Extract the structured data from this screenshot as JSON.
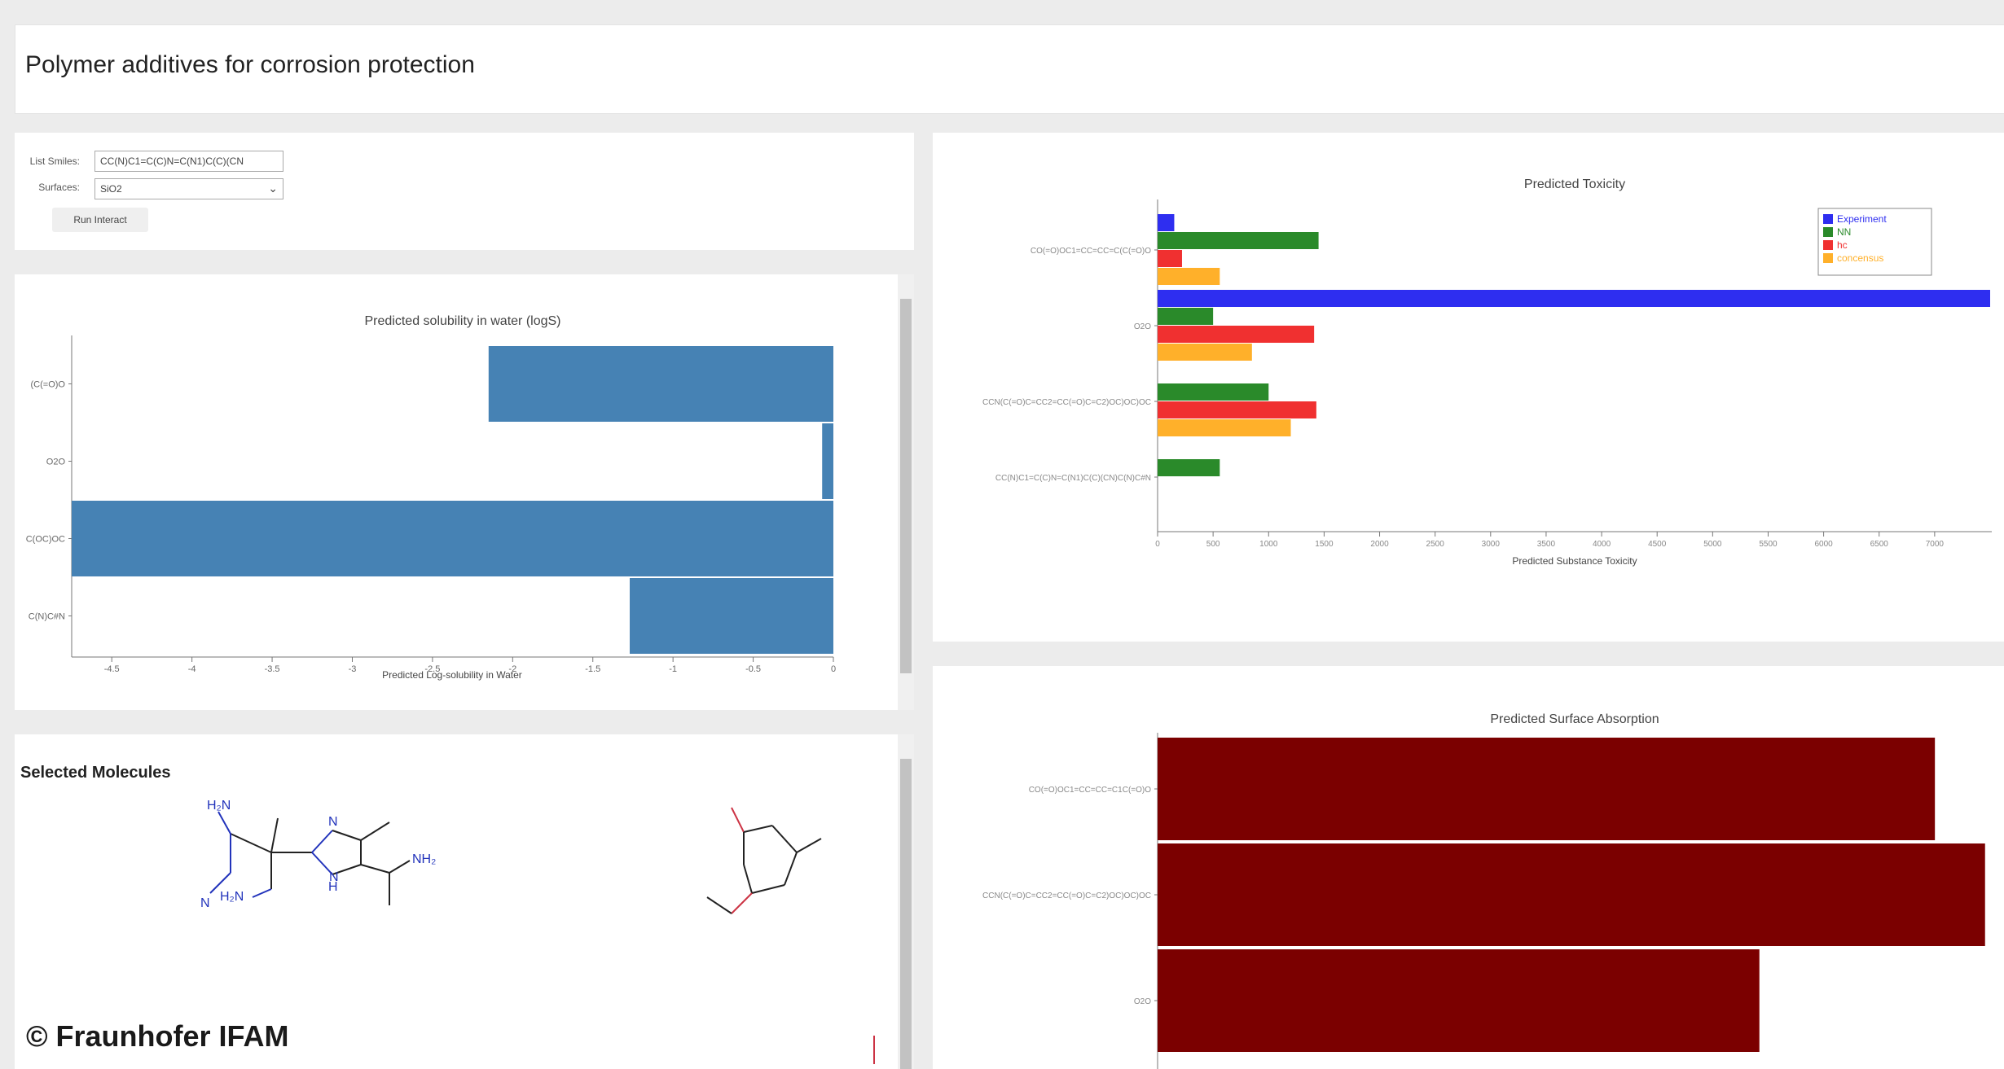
{
  "page": {
    "title": "Polymer additives for corrosion protection"
  },
  "controls": {
    "smiles_label": "List Smiles:",
    "smiles_value": "CC(N)C1=C(C)N=C(N1)C(C)(CN",
    "surfaces_label": "Surfaces:",
    "surfaces_value": "SiO2",
    "run_label": "Run Interact"
  },
  "solubility": {
    "chart_data": {
      "type": "bar",
      "orientation": "horizontal",
      "title": "Predicted solubility in water (logS)",
      "xlabel": "Predicted Log-solubility in Water",
      "ylabel": "",
      "categories": [
        "(C(=O)O",
        "O2O",
        "C(OC)OC",
        "C(N)C#N"
      ],
      "values": [
        -2.15,
        -0.07,
        -4.75,
        -1.27
      ],
      "xlim": [
        -4.75,
        0
      ],
      "xticks": [
        "-4.5",
        "-4",
        "-3.5",
        "-3",
        "-2.5",
        "-2",
        "-1.5",
        "-1",
        "-0.5",
        "0"
      ],
      "color": "#4682b4"
    }
  },
  "toxicity": {
    "chart_data": {
      "type": "bar",
      "orientation": "horizontal",
      "title": "Predicted Toxicity",
      "xlabel": "Predicted Substance Toxicity",
      "ylabel": "",
      "categories": [
        "CO(=O)OC1=CC=CC=C(C(=O)O",
        "O2O",
        "CCN(C(=O)C=CC2=CC(=O)C=C2)OC)OC)OC",
        "CC(N)C1=C(C)N=C(N1)C(C)(CN)C(N)C#N"
      ],
      "series": [
        {
          "name": "Experiment",
          "color": "#2e2ef0",
          "values": [
            150,
            7500,
            null,
            null
          ]
        },
        {
          "name": "NN",
          "color": "#2a8a2a",
          "values": [
            1450,
            500,
            1000,
            560
          ]
        },
        {
          "name": "hc",
          "color": "#f03030",
          "values": [
            220,
            1410,
            1430,
            null
          ]
        },
        {
          "name": "concensus",
          "color": "#ffb02a",
          "values": [
            560,
            850,
            1200,
            null
          ]
        }
      ],
      "xlim": [
        0,
        7500
      ],
      "xticks": [
        "0",
        "500",
        "1000",
        "1500",
        "2000",
        "2500",
        "3000",
        "3500",
        "4000",
        "4500",
        "5000",
        "5500",
        "6000",
        "6500",
        "7000"
      ],
      "legend": "top-right"
    }
  },
  "absorption": {
    "chart_data": {
      "type": "bar",
      "orientation": "horizontal",
      "title": "Predicted Surface Absorption",
      "xlabel": "",
      "ylabel": "",
      "categories": [
        "CO(=O)OC1=CC=CC=C1C(=O)O",
        "CCN(C(=O)C=CC2=CC(=O)C=C2)OC)OC)OC",
        "O2O"
      ],
      "values": [
        0.93,
        0.99,
        0.72
      ],
      "xlim": [
        0,
        1
      ],
      "color": "#7b0000"
    }
  },
  "molecules": {
    "heading": "Selected Molecules",
    "labels": {
      "h2n_top": "H₂N",
      "h2n_bottom": "H₂N",
      "n_nitrile": "N",
      "n_ring": "N",
      "h_ring": "H",
      "n_ring2": "N",
      "nh2": "NH₂"
    }
  },
  "watermark": "© Fraunhofer IFAM"
}
